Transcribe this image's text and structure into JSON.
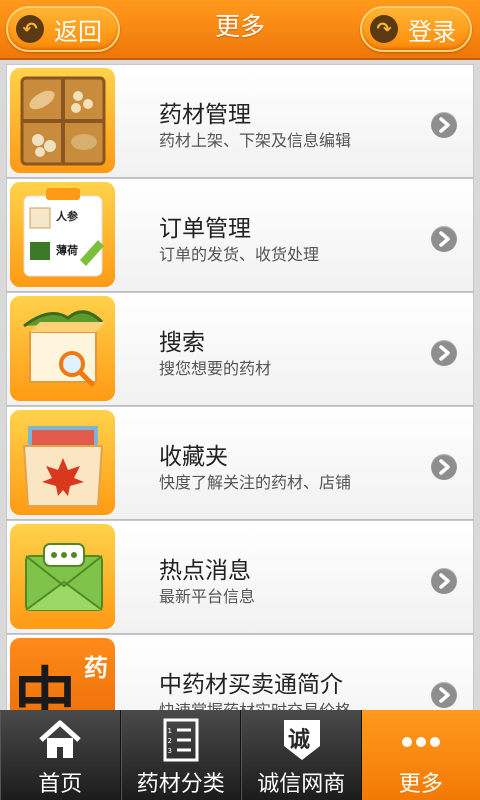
{
  "header": {
    "back_label": "返回",
    "title": "更多",
    "login_label": "登录"
  },
  "items": [
    {
      "title": "药材管理",
      "subtitle": "药材上架、下架及信息编辑"
    },
    {
      "title": "订单管理",
      "subtitle": "订单的发货、收货处理"
    },
    {
      "title": "搜索",
      "subtitle": "搜您想要的药材"
    },
    {
      "title": "收藏夹",
      "subtitle": "快度了解关注的药材、店铺"
    },
    {
      "title": "热点消息",
      "subtitle": "最新平台信息"
    },
    {
      "title": "中药材买卖通简介",
      "subtitle": "快速掌握药材实时交易价格"
    }
  ],
  "thumb_text": {
    "order_1": "人参",
    "order_2": "薄荷",
    "intro_big": "中",
    "intro_small": "药"
  },
  "tabs": [
    {
      "label": "首页",
      "icon": "home-icon"
    },
    {
      "label": "药材分类",
      "icon": "list-icon",
      "icon_text": "1 2 3"
    },
    {
      "label": "诚信网商",
      "icon": "shield-icon",
      "icon_text": "诚"
    },
    {
      "label": "更多",
      "icon": "more-icon",
      "active": true
    }
  ],
  "colors": {
    "accent": "#f7860f",
    "tabbar": "#2f2f2f"
  }
}
